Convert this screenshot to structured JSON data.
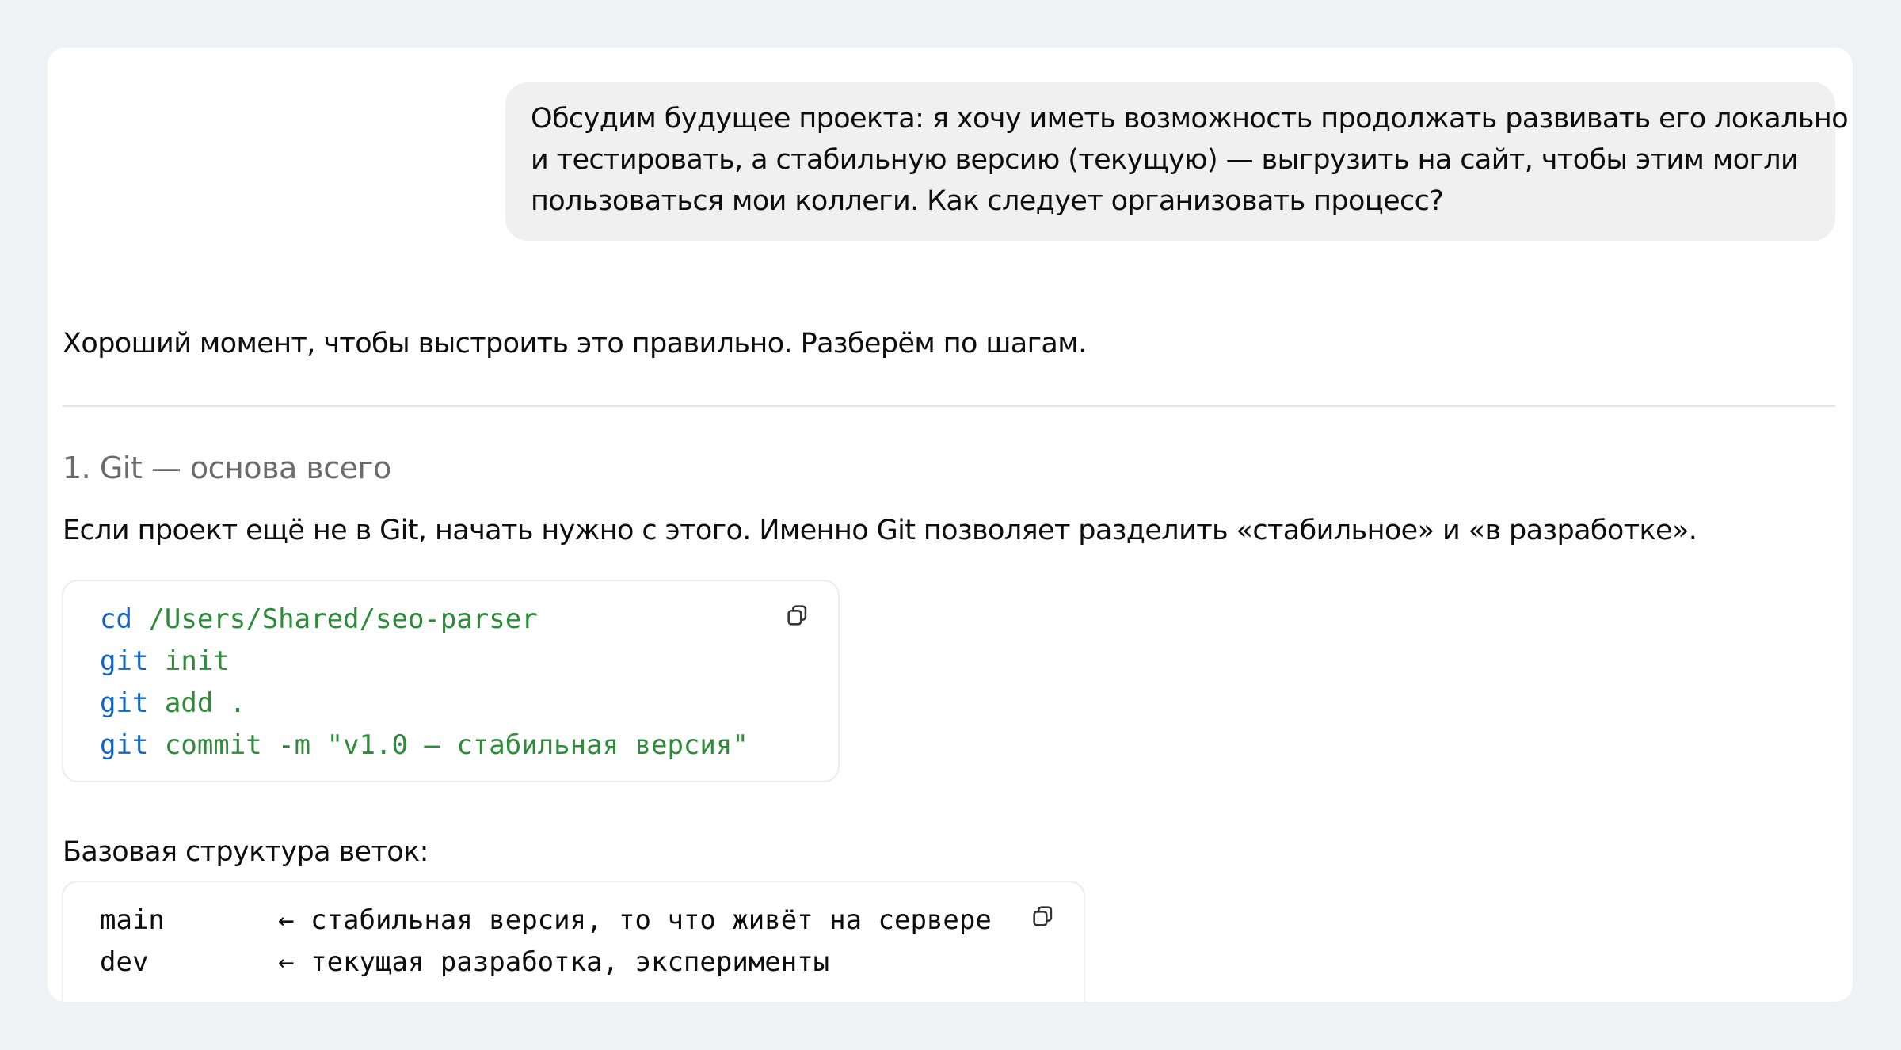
{
  "user_message": {
    "lines": [
      "Обсудим будущее проекта: я хочу иметь возможность продолжать развивать его локально",
      "и тестировать, а стабильную версию (текущую) — выгрузить на сайт, чтобы этим могли",
      "пользоваться мои коллеги. Как следует организовать процесс?"
    ]
  },
  "assistant": {
    "intro": "Хороший момент, чтобы выстроить это правильно. Разберём по шагам.",
    "section1_heading": "1. Git — основа всего",
    "section1_text": "Если проект ещё не в Git, начать нужно с этого. Именно Git позволяет разделить «стабильное» и «в разработке».",
    "code1": [
      {
        "cmd": "cd",
        "args": " /Users/Shared/seo-parser"
      },
      {
        "cmd": "git",
        "args": " init"
      },
      {
        "cmd": "git",
        "args": " add ."
      },
      {
        "cmd": "git",
        "args": " commit -m \"v1.0 — стабильная версия\""
      }
    ],
    "branches_label": "Базовая структура веток:",
    "code2": [
      "main       ← стабильная версия, то что живёт на сервере",
      "dev        ← текущая разработка, эксперименты"
    ],
    "copy_icon": "copy-icon"
  },
  "colors": {
    "keyword": "#1565c0",
    "argument": "#2e8b3a",
    "page_background": "#eff1f5",
    "user_bubble": "#f0f0f0"
  }
}
